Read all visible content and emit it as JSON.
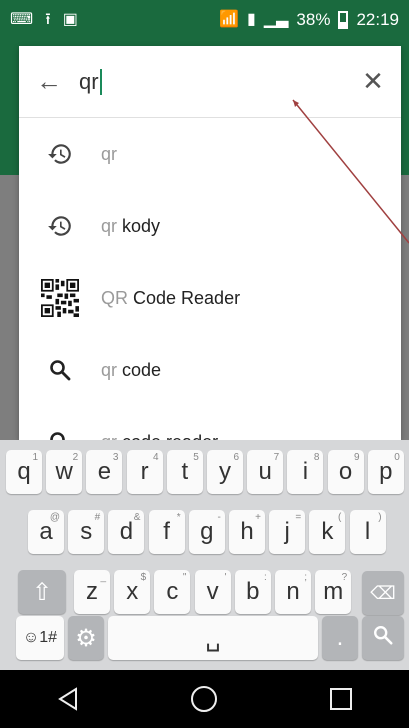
{
  "status_bar": {
    "battery": "38%",
    "time": "22:19",
    "icons": [
      "keyboard-icon",
      "upload-icon",
      "image-icon",
      "wifi-icon",
      "nfc-icon",
      "signal-icon",
      "battery-icon"
    ]
  },
  "search": {
    "query": "qr",
    "back_icon": "arrow-left-icon",
    "clear_icon": "close-icon"
  },
  "suggestions": [
    {
      "type": "history",
      "icon": "history-icon",
      "prefix": "qr",
      "rest": ""
    },
    {
      "type": "history",
      "icon": "history-icon",
      "prefix": "qr",
      "rest": " kody"
    },
    {
      "type": "app",
      "icon": "qr-app-icon",
      "prefix": "QR",
      "rest": " Code Reader"
    },
    {
      "type": "search",
      "icon": "search-icon",
      "prefix": "qr",
      "rest": " code"
    },
    {
      "type": "search",
      "icon": "search-icon",
      "prefix": "qr",
      "rest": " code reader"
    }
  ],
  "keyboard": {
    "row1": [
      {
        "k": "q",
        "s": "1"
      },
      {
        "k": "w",
        "s": "2"
      },
      {
        "k": "e",
        "s": "3"
      },
      {
        "k": "r",
        "s": "4"
      },
      {
        "k": "t",
        "s": "5"
      },
      {
        "k": "y",
        "s": "6"
      },
      {
        "k": "u",
        "s": "7"
      },
      {
        "k": "i",
        "s": "8"
      },
      {
        "k": "o",
        "s": "9"
      },
      {
        "k": "p",
        "s": "0"
      }
    ],
    "row2": [
      {
        "k": "a",
        "s": "@"
      },
      {
        "k": "s",
        "s": "#"
      },
      {
        "k": "d",
        "s": "&"
      },
      {
        "k": "f",
        "s": "*"
      },
      {
        "k": "g",
        "s": "-"
      },
      {
        "k": "h",
        "s": "+"
      },
      {
        "k": "j",
        "s": "="
      },
      {
        "k": "k",
        "s": "("
      },
      {
        "k": "l",
        "s": ")"
      }
    ],
    "row3": [
      {
        "k": "z",
        "s": "_"
      },
      {
        "k": "x",
        "s": "$"
      },
      {
        "k": "c",
        "s": "\""
      },
      {
        "k": "v",
        "s": "'"
      },
      {
        "k": "b",
        "s": ":"
      },
      {
        "k": "n",
        "s": ";"
      },
      {
        "k": "m",
        "s": "?"
      }
    ],
    "symbols_label": "☺1#",
    "space_label": "␣"
  },
  "nav": [
    "back-icon",
    "home-icon",
    "recents-icon"
  ],
  "colors": {
    "app_green": "#1a6a3e",
    "annotation": "#a04040"
  }
}
